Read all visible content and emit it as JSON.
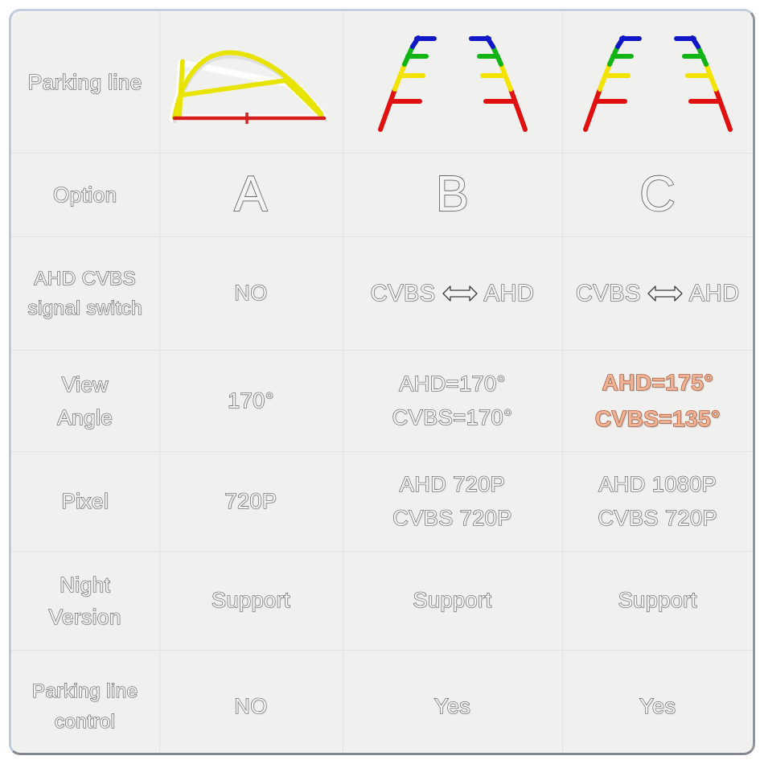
{
  "table": {
    "columns": [
      "",
      "A",
      "B",
      "C"
    ],
    "rows": [
      {
        "key": "parking_line",
        "label": "Parking line",
        "type": "graphic",
        "a": "curved-yellow-parking-arc",
        "b": "color-segmented-guide-pair",
        "c": "color-segmented-guide-pair"
      },
      {
        "key": "option",
        "label": "Option",
        "type": "text",
        "a": "A",
        "b": "B",
        "c": "C"
      },
      {
        "key": "signal_switch",
        "label": "AHD CVBS\nsignal switch",
        "type": "signal",
        "a": "NO",
        "b_left": "CVBS",
        "b_right": "AHD",
        "c_left": "CVBS",
        "c_right": "AHD"
      },
      {
        "key": "view_angle",
        "label": "View\nAngle",
        "type": "text",
        "a": "170°",
        "b": "AHD=170°\nCVBS=170°",
        "c": "AHD=175°\nCVBS=135°",
        "c_highlight": true
      },
      {
        "key": "pixel",
        "label": "Pixel",
        "type": "text",
        "a": "720P",
        "b": "AHD 720P\nCVBS 720P",
        "c": "AHD 1080P\nCVBS 720P"
      },
      {
        "key": "night_version",
        "label": "Night\nVersion",
        "type": "text",
        "a": "Support",
        "b": "Support",
        "c": "Support"
      },
      {
        "key": "parking_line_control",
        "label": "Parking line\ncontrol",
        "type": "text",
        "a": "NO",
        "b": "Yes",
        "c": "Yes"
      }
    ]
  },
  "graphics": {
    "parking_arc": {
      "name": "curved-yellow-parking-arc",
      "dash_color": "#e8e400",
      "baseline_color": "#d52020",
      "outline_color": "#ffffff"
    },
    "guide_line": {
      "name": "color-segmented-guide",
      "segments": [
        {
          "color": "#1018c8",
          "label": "blue"
        },
        {
          "color": "#11b414",
          "label": "green"
        },
        {
          "color": "#f2e400",
          "label": "yellow"
        },
        {
          "color": "#e01010",
          "label": "red"
        }
      ]
    }
  },
  "colors": {
    "page_background": "#f0f0ee",
    "grid_line": "#e3e3e1",
    "frame_light": "#c3cfe0",
    "frame_dark": "#82878f",
    "text_outline": "#3c3c3c",
    "text_fill": "#f4f4f2",
    "highlight_fill": "#eeb295",
    "highlight_outline": "#a63e1c"
  }
}
